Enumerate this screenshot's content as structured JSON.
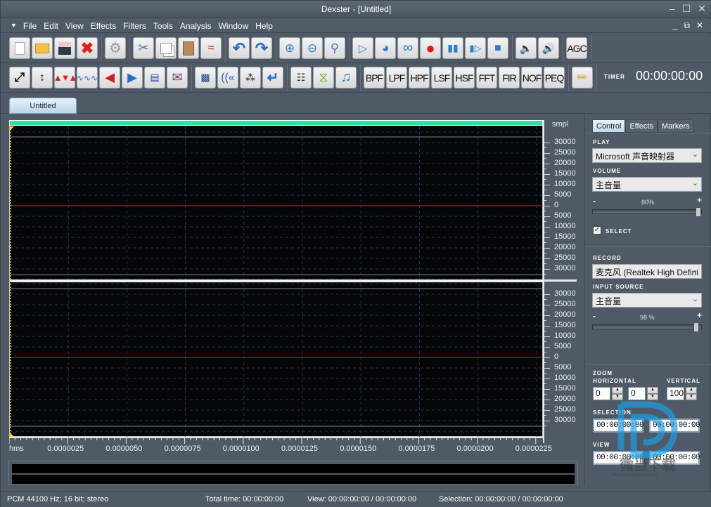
{
  "window": {
    "title": "Dexster - [Untitled]",
    "controls": [
      "minimize",
      "maximize",
      "close"
    ]
  },
  "menu": {
    "items": [
      "File",
      "Edit",
      "View",
      "Effects",
      "Filters",
      "Tools",
      "Analysis",
      "Window",
      "Help"
    ]
  },
  "toolbar1": {
    "buttons": [
      {
        "name": "new-file",
        "icon": "document-icon"
      },
      {
        "name": "open-file",
        "icon": "folder-open-icon"
      },
      {
        "name": "save-file",
        "icon": "floppy-icon"
      },
      {
        "name": "close-file",
        "icon": "red-x-icon"
      },
      {
        "name": "settings",
        "icon": "gear-icon"
      },
      {
        "name": "cut",
        "icon": "scissors-icon"
      },
      {
        "name": "copy",
        "icon": "copy-icon"
      },
      {
        "name": "paste",
        "icon": "clipboard-icon"
      },
      {
        "name": "mix-paste",
        "icon": "wave-mix-icon"
      },
      {
        "name": "undo",
        "icon": "undo-icon"
      },
      {
        "name": "redo",
        "icon": "redo-icon"
      },
      {
        "name": "zoom-in",
        "icon": "zoom-in-icon"
      },
      {
        "name": "zoom-out",
        "icon": "zoom-out-icon"
      },
      {
        "name": "zoom-fit",
        "icon": "zoom-fit-icon"
      },
      {
        "name": "play",
        "icon": "play-icon"
      },
      {
        "name": "play-selection",
        "icon": "play-circle-icon"
      },
      {
        "name": "loop",
        "icon": "loop-icon"
      },
      {
        "name": "record",
        "icon": "record-icon"
      },
      {
        "name": "pause",
        "icon": "pause-icon"
      },
      {
        "name": "play-next",
        "icon": "step-forward-icon"
      },
      {
        "name": "stop",
        "icon": "stop-icon"
      },
      {
        "name": "speaker-left",
        "icon": "speaker-left-icon"
      },
      {
        "name": "speaker-right",
        "icon": "speaker-right-icon"
      },
      {
        "name": "agc",
        "label": "AGC"
      }
    ]
  },
  "toolbar2": {
    "buttons": [
      {
        "name": "stretch",
        "icon": "expand-arrows-icon"
      },
      {
        "name": "compress",
        "icon": "compress-arrows-icon"
      },
      {
        "name": "noise",
        "icon": "noise-wave-icon"
      },
      {
        "name": "silence",
        "icon": "silence-wave-icon"
      },
      {
        "name": "fade-in",
        "icon": "fade-in-icon"
      },
      {
        "name": "fade-out",
        "icon": "fade-out-icon"
      },
      {
        "name": "normalize",
        "icon": "normalize-icon"
      },
      {
        "name": "envelope",
        "icon": "envelope-icon"
      },
      {
        "name": "distortion",
        "icon": "distortion-icon"
      },
      {
        "name": "echo",
        "icon": "echo-icon"
      },
      {
        "name": "reverb",
        "icon": "reverb-icon"
      },
      {
        "name": "reverse",
        "icon": "reverse-arrow-icon"
      },
      {
        "name": "pitch",
        "icon": "pitch-icon"
      },
      {
        "name": "invert",
        "icon": "invert-arrows-icon"
      },
      {
        "name": "music",
        "icon": "music-note-icon"
      },
      {
        "name": "bpf",
        "label": "BPF"
      },
      {
        "name": "lpf",
        "label": "LPF"
      },
      {
        "name": "hpf",
        "label": "HPF"
      },
      {
        "name": "lsf",
        "label": "LSF"
      },
      {
        "name": "hsf",
        "label": "HSF"
      },
      {
        "name": "fft",
        "label": "FFT"
      },
      {
        "name": "fir",
        "label": "FIR"
      },
      {
        "name": "nof",
        "label": "NOF"
      },
      {
        "name": "peq",
        "label": "PEQ"
      },
      {
        "name": "notes",
        "icon": "pencil-note-icon"
      }
    ],
    "timer_label": "TIMER",
    "timer_value": "00:00:00:00"
  },
  "document_tab": "Untitled",
  "waveform": {
    "y_unit": "smpl",
    "y_labels_top": [
      "30000",
      "25000",
      "20000",
      "15000",
      "10000",
      "5000",
      "0",
      "5000",
      "10000",
      "15000",
      "20000",
      "25000",
      "30000"
    ],
    "y_labels_bottom": [
      "30000",
      "25000",
      "20000",
      "15000",
      "10000",
      "5000",
      "0",
      "5000",
      "10000",
      "15000",
      "20000",
      "25000",
      "30000"
    ],
    "x_unit": "hms",
    "x_labels": [
      "0.0000025",
      "0.0000050",
      "0.0000075",
      "0.0000100",
      "0.0000125",
      "0.0000150",
      "0.0000175",
      "0.0000200",
      "0.0000225"
    ],
    "colors": {
      "background": "#050608",
      "grid": "#1c3a5e",
      "zero_line": "#b03030",
      "header_bar": "#2fe0a0",
      "cursor": "#ffe000"
    }
  },
  "panel": {
    "tabs": [
      "Control",
      "Effects",
      "Markers"
    ],
    "active_tab": "Control",
    "play_label": "PLAY",
    "play_device": "Microsoft 声音映射器",
    "volume_label": "VOLUME",
    "volume_source": "主音量",
    "volume_minus": "-",
    "volume_plus": "+",
    "volume_pct_text": "80%",
    "volume_level": 1.0,
    "select_label": "SELECT",
    "select_checked": true,
    "record_label": "RECORD",
    "record_device": "麦克风 (Realtek High Defini",
    "input_source_label": "INPUT SOURCE",
    "input_source": "主音量",
    "input_minus": "-",
    "input_plus": "+",
    "input_pct_text": "98 %",
    "input_level": 0.98,
    "zoom_label": "ZOOM",
    "horizontal_label": "HORIZONTAL",
    "vertical_label": "VERTICAL",
    "zoom_h1": "0",
    "zoom_h2": "0",
    "zoom_v": "100",
    "selection_label": "SELECTION",
    "selection_start": "00:00:00:00",
    "selection_end": "00:00:00:00",
    "view_label": "VIEW",
    "view_start": "00:00:00:00",
    "view_end": "00:00:00:00"
  },
  "status": {
    "format": "PCM 44100 Hz; 16 bit; stereo",
    "total_time": "Total time: 00:00:00:00",
    "view": "View: 00:00:00:00 / 00:00:00:00",
    "selection": "Selection: 00:00:00:00 / 00:00:00:00"
  },
  "watermark": {
    "text": "微当下载",
    "url_text": "WWW.WEIDOWN.COM"
  }
}
